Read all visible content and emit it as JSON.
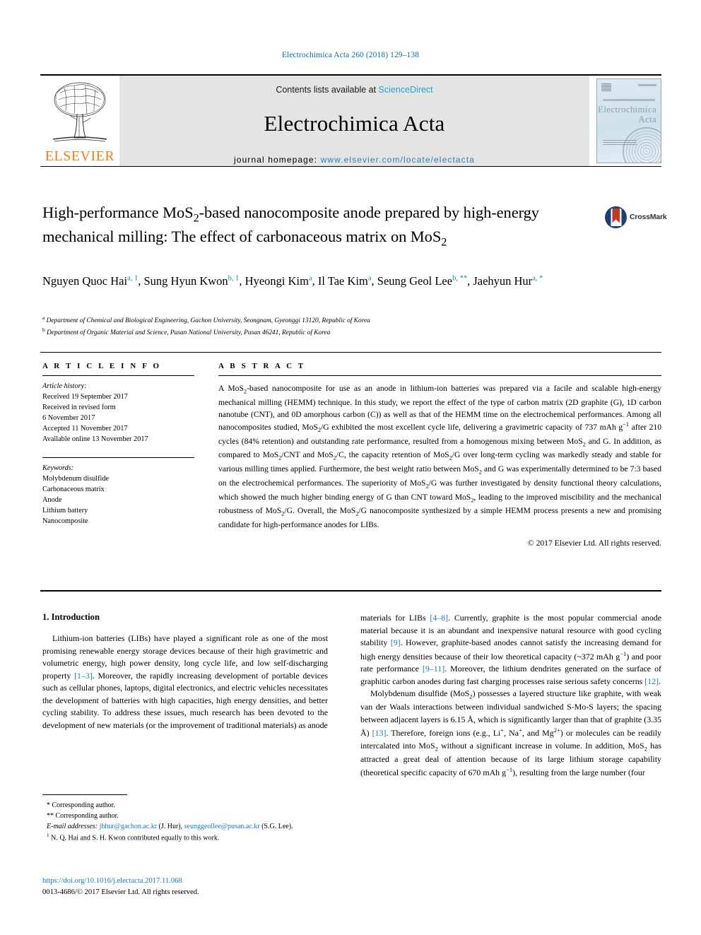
{
  "running_head": "Electrochimica Acta 260 (2018) 129–138",
  "masthead": {
    "publisher": "ELSEVIER",
    "contents_prefix": "Contents lists available at ",
    "contents_link": "ScienceDirect",
    "journal_title": "Electrochimica Acta",
    "homepage_label": "journal homepage: ",
    "homepage_url": "www.elsevier.com/locate/electacta",
    "cover_title_line1": "Electrochimica",
    "cover_title_line2": "Acta"
  },
  "crossmark": {
    "label": "CrossMark"
  },
  "article": {
    "title_line1": "High-performance MoS",
    "title_sub1": "2",
    "title_line1b": "-based nanocomposite anode prepared by",
    "title_line2": "high-energy mechanical milling: The effect of carbonaceous matrix on",
    "title_line3": "MoS",
    "title_sub3": "2"
  },
  "authors": {
    "list": [
      {
        "name": "Nguyen Quoc Hai",
        "marks": "a, 1"
      },
      {
        "name": "Sung Hyun Kwon",
        "marks": "b, 1"
      },
      {
        "name": "Hyeongi Kim",
        "marks": "a"
      },
      {
        "name": "Il Tae Kim",
        "marks": "a"
      },
      {
        "name": "Seung Geol Lee",
        "marks": "b, **"
      },
      {
        "name": "Jaehyun Hur",
        "marks": "a, *"
      }
    ],
    "affiliations": [
      {
        "mark": "a",
        "text": "Department of Chemical and Biological Engineering, Gachon University, Seongnam, Gyeonggi 13120, Republic of Korea"
      },
      {
        "mark": "b",
        "text": "Department of Organic Material and Science, Pusan National University, Pusan 46241, Republic of Korea"
      }
    ]
  },
  "article_info": {
    "heading": "A R T I C L E   I N F O",
    "history_label": "Article history:",
    "history": [
      "Received 19 September 2017",
      "Received in revised form",
      "6 November 2017",
      "Accepted 11 November 2017",
      "Available online 13 November 2017"
    ],
    "keywords_label": "Keywords:",
    "keywords": [
      "Molybdenum disulfide",
      "Carbonaceous matrix",
      "Anode",
      "Lithium battery",
      "Nanocomposite"
    ]
  },
  "abstract": {
    "heading": "A B S T R A C T",
    "paragraph_html": "A MoS<sub>2</sub>-based nanocomposite for use as an anode in lithium-ion batteries was prepared via a facile and scalable high-energy mechanical milling (HEMM) technique. In this study, we report the effect of the type of carbon matrix (2D graphite (G), 1D carbon nanotube (CNT), and 0D amorphous carbon (C)) as well as that of the HEMM time on the electrochemical performances. Among all nanocomposites studied, MoS<sub>2</sub>/G exhibited the most excellent cycle life, delivering a gravimetric capacity of 737 mAh g<sup>−1</sup> after 210 cycles (84% retention) and outstanding rate performance, resulted from a homogenous mixing between MoS<sub>2</sub> and G. In addition, as compared to MoS<sub>2</sub>/CNT and MoS<sub>2</sub>/C, the capacity retention of MoS<sub>2</sub>/G over long-term cycling was markedly steady and stable for various milling times applied. Furthermore, the best weight ratio between MoS<sub>2</sub> and G was experimentally determined to be 7:3 based on the electrochemical performances. The superiority of MoS<sub>2</sub>/G was further investigated by density functional theory calculations, which showed the much higher binding energy of G than CNT toward MoS<sub>2</sub>, leading to the improved miscibility and the mechanical robustness of MoS<sub>2</sub>/G. Overall, the MoS<sub>2</sub>/G nanocomposite synthesized by a simple HEMM process presents a new and promising candidate for high-performance anodes for LIBs.",
    "copyright": "© 2017 Elsevier Ltd. All rights reserved."
  },
  "introduction": {
    "heading": "1. Introduction",
    "left_paragraph_html": "Lithium-ion batteries (LIBs) have played a significant role as one of the most promising renewable energy storage devices because of their high gravimetric and volumetric energy, high power density, long cycle life, and low self-discharging property <span class=\"ref\">[1–3]</span>. Moreover, the rapidly increasing development of portable devices such as cellular phones, laptops, digital electronics, and electric vehicles necessitates the development of batteries with high capacities, high energy densities, and better cycling stability. To address these issues, much research has been devoted to the development of new materials (or the improvement of traditional materials) as anode",
    "right_paragraph1_html": "materials for LIBs <span class=\"ref\">[4–8]</span>. Currently, graphite is the most popular commercial anode material because it is an abundant and inexpensive natural resource with good cycling stability <span class=\"ref\">[9]</span>. However, graphite-based anodes cannot satisfy the increasing demand for high energy densities because of their low theoretical capacity (~372 mAh g<sup>−1</sup>) and poor rate performance <span class=\"ref\">[9–11]</span>. Moreover, the lithium dendrites generated on the surface of graphitic carbon anodes during fast charging processes raise serious safety concerns <span class=\"ref\">[12]</span>.",
    "right_paragraph2_html": "Molybdenum disulfide (MoS<sub>2</sub>) possesses a layered structure like graphite, with weak van der Waals interactions between individual sandwiched S-Mo-S layers; the spacing between adjacent layers is 6.15 Å, which is significantly larger than that of graphite (3.35 Å) <span class=\"ref\">[13]</span>. Therefore, foreign ions (e.g., Li<sup>+</sup>, Na<sup>+</sup>, and Mg<sup>2+</sup>) or molecules can be readily intercalated into MoS<sub>2</sub> without a significant increase in volume. In addition, MoS<sub>2</sub> has attracted a great deal of attention because of its large lithium storage capability (theoretical specific capacity of 670 mAh g<sup>−1</sup>), resulting from the large number (four"
  },
  "footnotes": {
    "corresponding1": "* Corresponding author.",
    "corresponding2": "** Corresponding author.",
    "email_label": "E-mail addresses:",
    "email1": "jhhur@gachon.ac.kr",
    "email1_person": "(J. Hur),",
    "email2": "seunggeollee@pusan.ac.kr",
    "email2_person": "(S.G. Lee).",
    "equal_contrib": "N. Q. Hai and S. H. Kwon contributed equally to this work.",
    "equal_contrib_mark": "1"
  },
  "doi_block": {
    "doi": "https://doi.org/10.1016/j.electacta.2017.11.068",
    "issn_line": "0013-4686/© 2017 Elsevier Ltd. All rights reserved."
  }
}
